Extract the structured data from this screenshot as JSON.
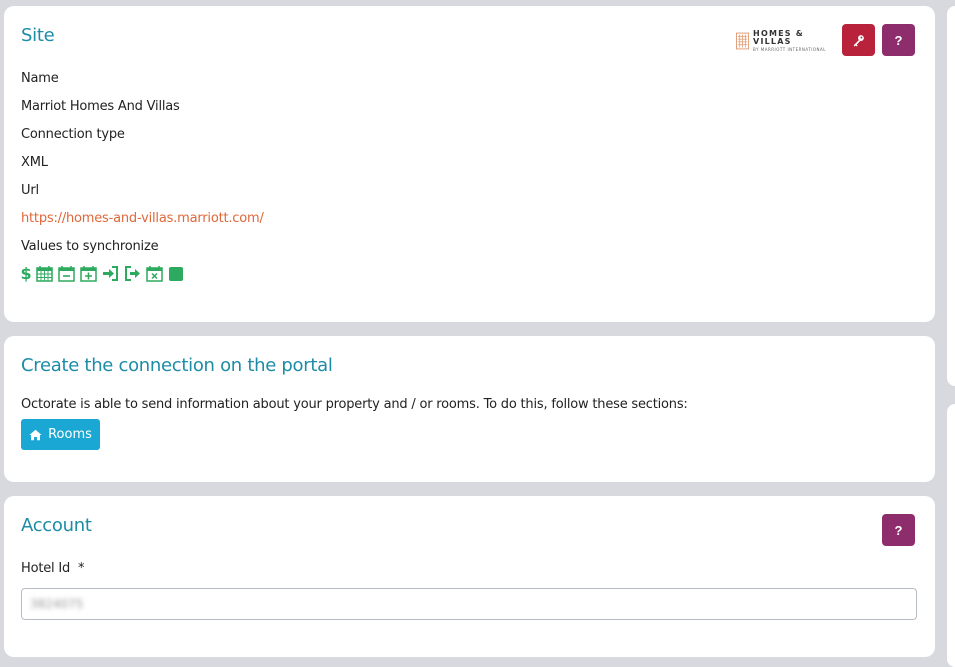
{
  "site": {
    "title": "Site",
    "logo_main": "HOMES & VILLAS",
    "logo_sub": "BY MARRIOTT INTERNATIONAL",
    "key_icon": "key-icon",
    "help_label": "?",
    "name_label": "Name",
    "name_value": "Marriot Homes And Villas",
    "connection_label": "Connection type",
    "connection_value": "XML",
    "url_label": "Url",
    "url_value": "https://homes-and-villas.marriott.com/",
    "sync_label": "Values to synchronize",
    "sync_icons": [
      "dollar-icon",
      "calendar-grid-icon",
      "calendar-minus-icon",
      "calendar-plus-icon",
      "sign-in-icon",
      "sign-out-icon",
      "calendar-times-icon",
      "square-icon"
    ]
  },
  "portal": {
    "title": "Create the connection on the portal",
    "description": "Octorate is able to send information about your property and / or rooms. To do this, follow these sections:",
    "rooms_label": "Rooms"
  },
  "account": {
    "title": "Account",
    "help_label": "?",
    "hotel_id_label": "Hotel Id",
    "required_mark": "*",
    "hotel_id_value": "3824075"
  },
  "colors": {
    "accent": "#1c8ca7",
    "link": "#e0673a",
    "green": "#2daa5f",
    "red_button": "#b8223a",
    "purple_button": "#8e2d6b",
    "blue_button": "#1aa7d3"
  }
}
